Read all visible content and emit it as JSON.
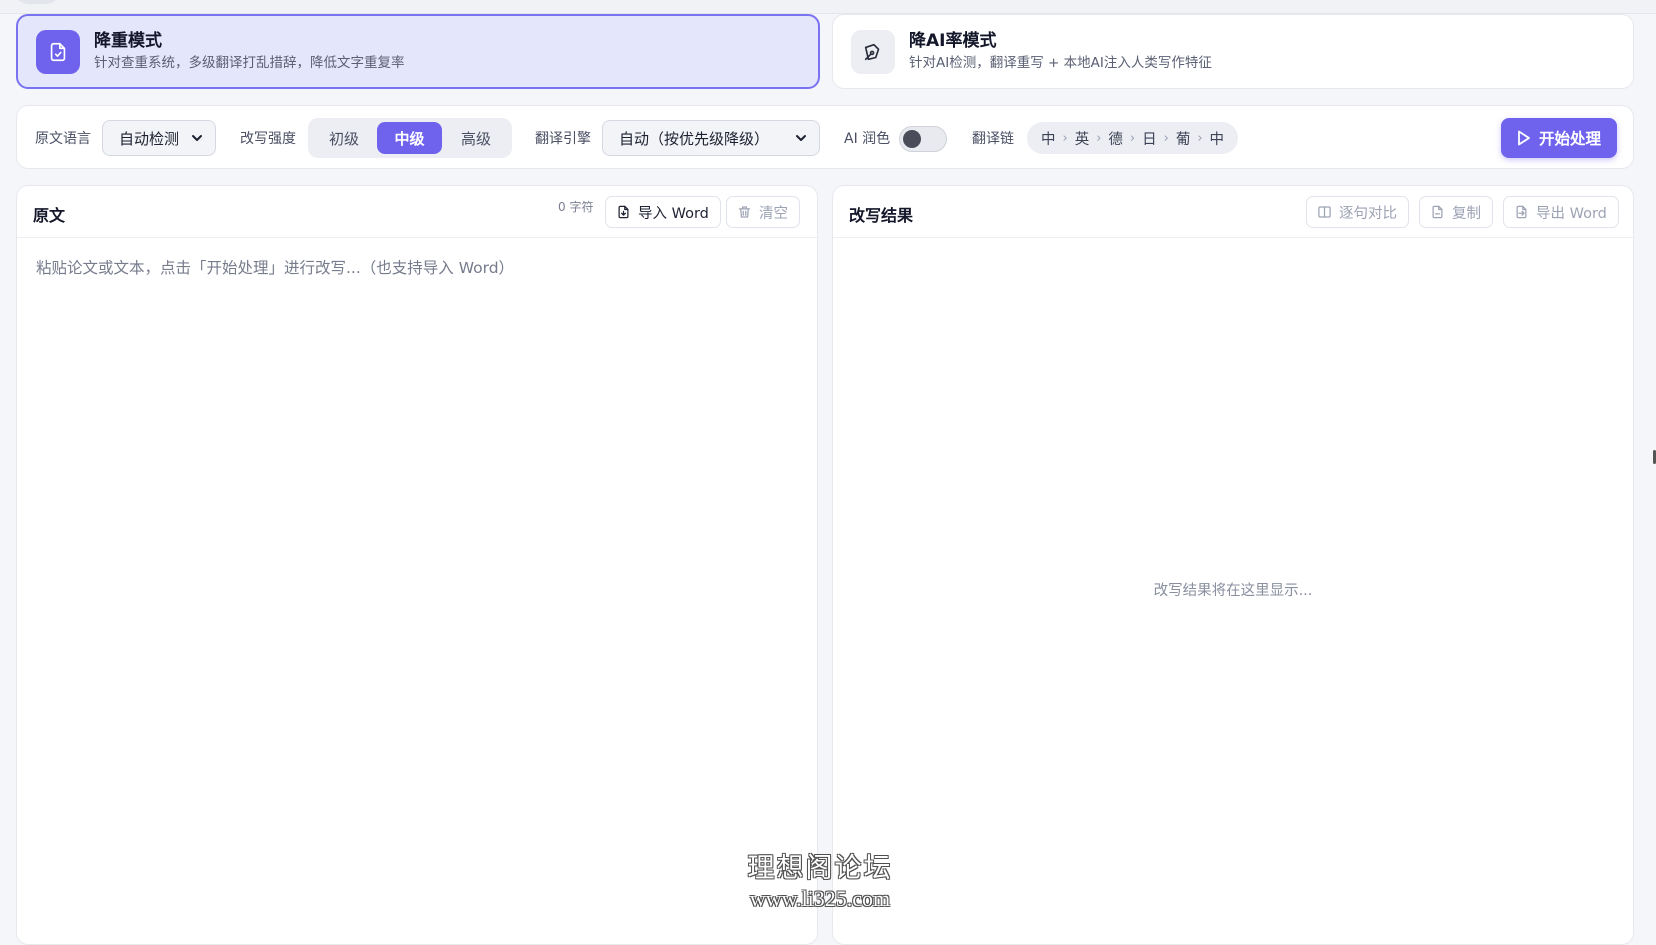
{
  "modes": {
    "dedup": {
      "title": "降重模式",
      "desc": "针对查重系统，多级翻译打乱措辞，降低文字重复率",
      "icon": "document-icon",
      "active": true
    },
    "ai": {
      "title": "降AI率模式",
      "desc": "针对AI检测，翻译重写 + 本地AI注入人类写作特征",
      "icon": "pen-icon",
      "active": false
    }
  },
  "toolbar": {
    "source_lang_label": "原文语言",
    "source_lang_value": "自动检测",
    "strength_label": "改写强度",
    "strength_options": [
      "初级",
      "中级",
      "高级"
    ],
    "strength_selected": "中级",
    "engine_label": "翻译引擎",
    "engine_value": "自动（按优先级降级）",
    "ai_polish_label": "AI 润色",
    "ai_polish_on": false,
    "chain_label": "翻译链",
    "chain": [
      "中",
      "英",
      "德",
      "日",
      "葡",
      "中"
    ],
    "start_label": "开始处理",
    "accent": "#6f63ee"
  },
  "source_panel": {
    "title": "原文",
    "char_count": "0 字符",
    "import_label": "导入 Word",
    "clear_label": "清空",
    "placeholder": "粘贴论文或文本，点击「开始处理」进行改写...（也支持导入 Word）",
    "value": ""
  },
  "result_panel": {
    "title": "改写结果",
    "compare_label": "逐句对比",
    "copy_label": "复制",
    "export_label": "导出 Word",
    "empty_text": "改写结果将在这里显示..."
  },
  "watermark": {
    "line1": "理想阁论坛",
    "line2": "www.li325.com"
  }
}
